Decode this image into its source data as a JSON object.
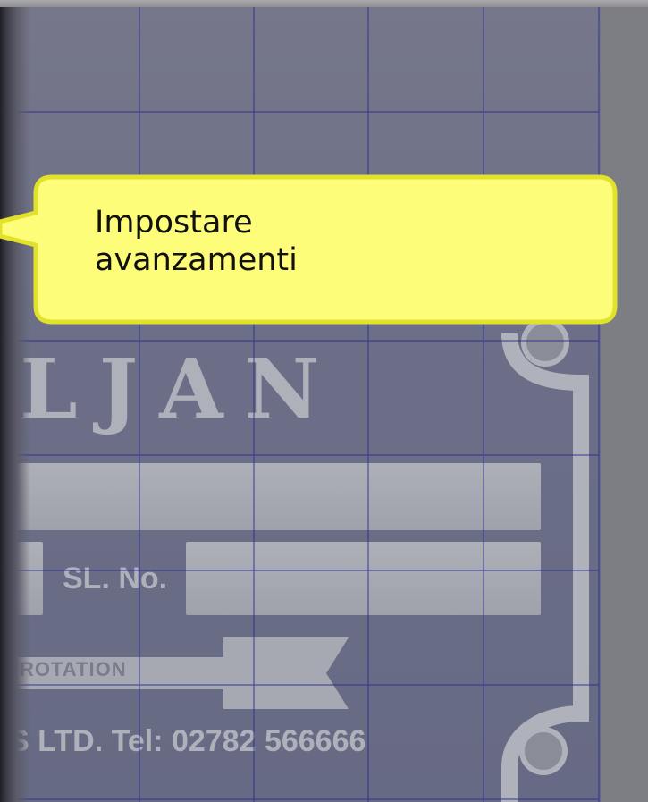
{
  "callout": {
    "text_line1": "Impostare",
    "text_line2": "avanzamenti",
    "fill": "#fdfd7a",
    "border": "#e2e22a"
  },
  "plate": {
    "brand_text": "LJAN",
    "serial_label": "SL. No.",
    "rotation_label": "ROTATION",
    "footer_text": "S LTD.   Tel: 02782 566666"
  },
  "colors": {
    "overlay": "#7f7f86",
    "grid_line": "#2a2f8f"
  }
}
